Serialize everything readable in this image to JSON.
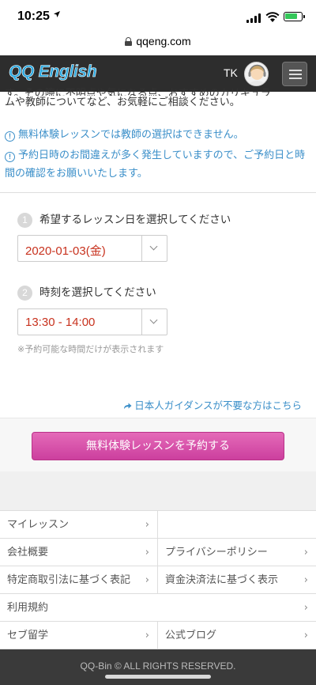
{
  "status_bar": {
    "time": "10:25",
    "battery_level": 0.8,
    "battery_color": "#34c759"
  },
  "browser": {
    "url": "qqeng.com"
  },
  "header": {
    "logo_q": "QQ",
    "logo_rest": " English",
    "user_initials": "TK",
    "brand_color": "#29a8e0"
  },
  "intro": {
    "partial_line": "す。その際に不明点や気になる点、おすすめのカリキュラ",
    "line2": "ムや教師についてなど、お気軽にご相談ください。"
  },
  "notices": [
    "無料体験レッスンでは教師の選択はできません。",
    "予約日時のお間違えが多く発生していますので、ご予約日と時間の確認をお願いいたします。"
  ],
  "steps": [
    {
      "number": "1",
      "label": "希望するレッスン日を選択してください",
      "selected": "2020-01-03(金)"
    },
    {
      "number": "2",
      "label": "時刻を選択してください",
      "selected": "13:30 - 14:00"
    }
  ],
  "select_note": "※予約可能な時間だけが表示されます",
  "guidance_link": "日本人ガイダンスが不要な方はこちら",
  "cta_label": "無料体験レッスンを予約する",
  "footer": {
    "links": [
      {
        "left": "マイレッスン",
        "right": ""
      },
      {
        "left": "会社概要",
        "right": "プライバシーポリシー"
      },
      {
        "left": "特定商取引法に基づく表記",
        "right": "資金決済法に基づく表示"
      },
      {
        "full": "利用規約"
      },
      {
        "left": "セブ留学",
        "right": "公式ブログ"
      }
    ],
    "chevron": "›",
    "copyright": "QQ-Bin © ALL RIGHTS RESERVED."
  }
}
